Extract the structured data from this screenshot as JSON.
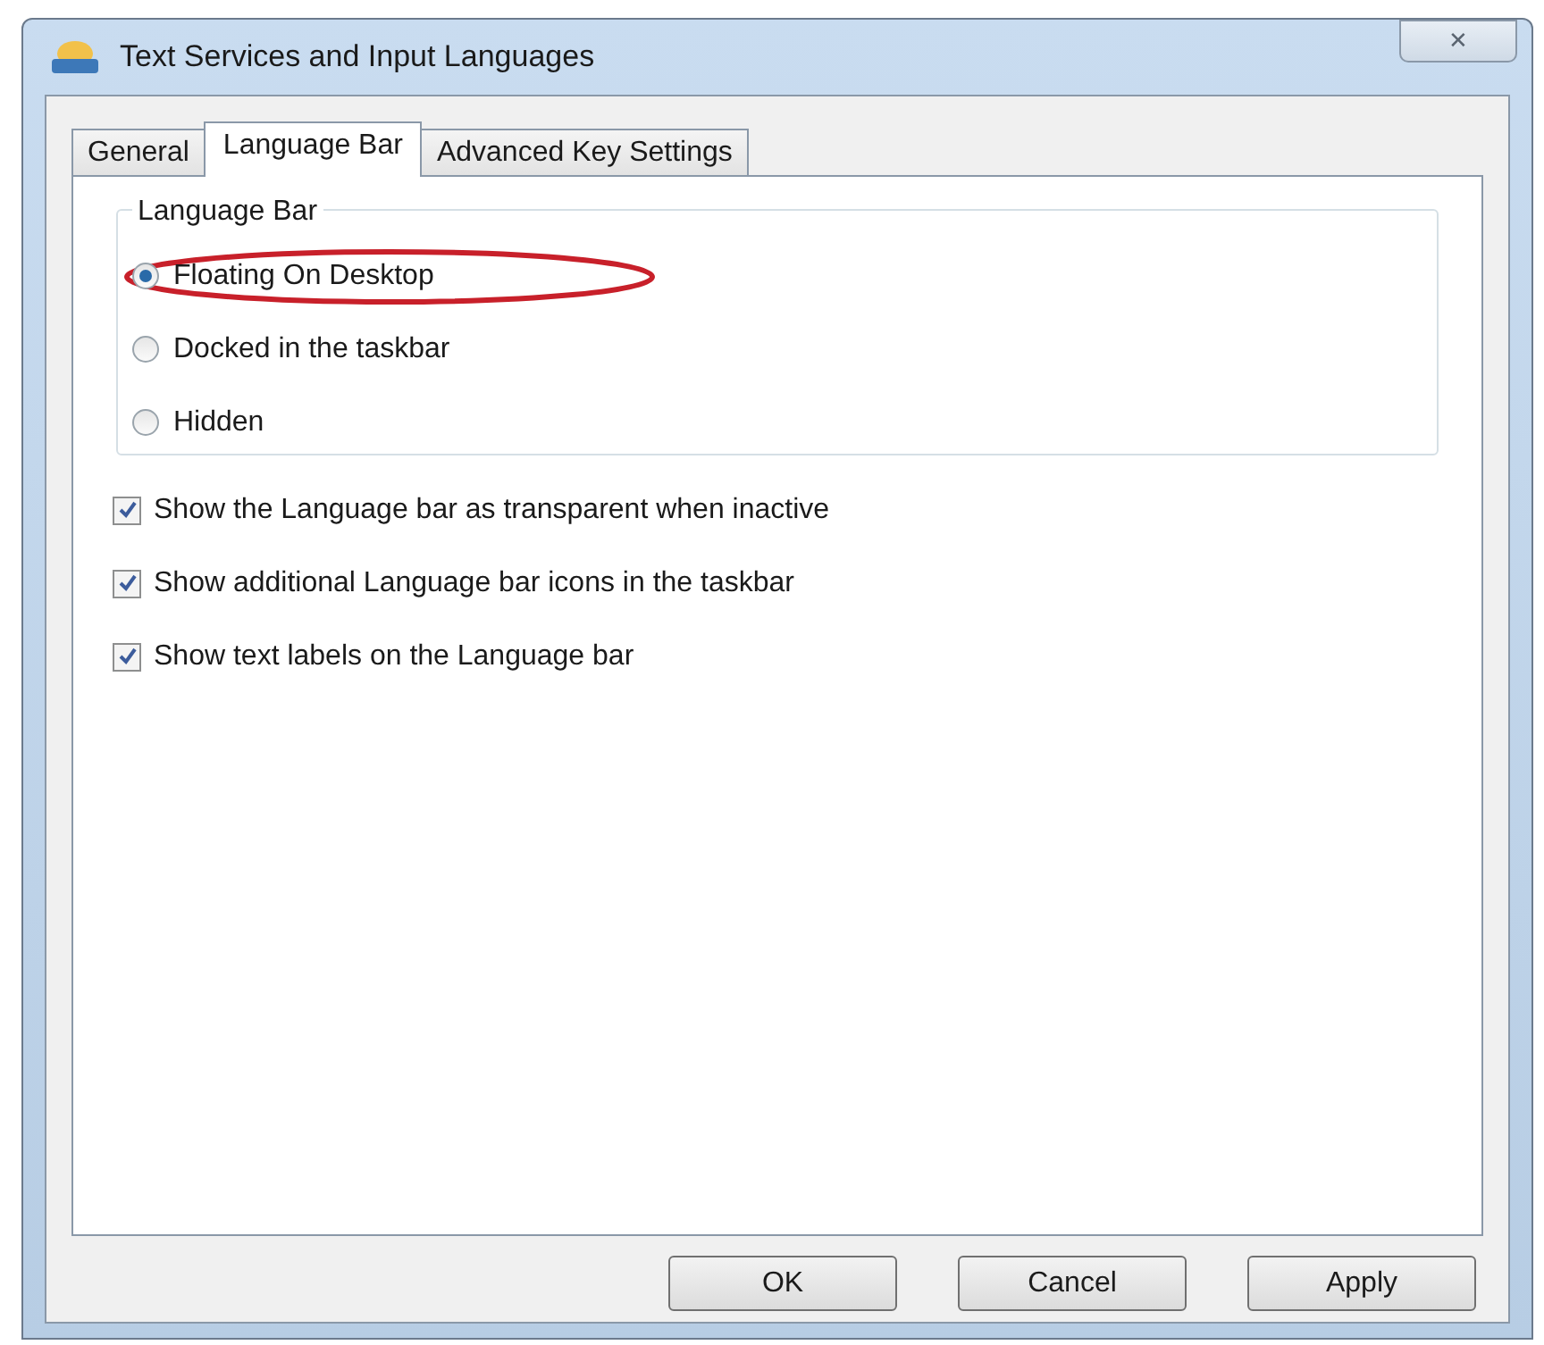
{
  "window": {
    "title": "Text Services and Input Languages",
    "close": "✕"
  },
  "tabs": [
    {
      "label": "General",
      "selected": false
    },
    {
      "label": "Language Bar",
      "selected": true
    },
    {
      "label": "Advanced Key Settings",
      "selected": false
    }
  ],
  "group": {
    "legend": "Language Bar",
    "options": [
      {
        "label": "Floating On Desktop",
        "selected": true,
        "highlighted": true
      },
      {
        "label": "Docked in the taskbar",
        "selected": false,
        "highlighted": false
      },
      {
        "label": "Hidden",
        "selected": false,
        "highlighted": false
      }
    ]
  },
  "checkboxes": [
    {
      "label": "Show the Language bar as transparent when inactive",
      "checked": true
    },
    {
      "label": "Show additional Language bar icons in the taskbar",
      "checked": true
    },
    {
      "label": "Show text labels on the Language bar",
      "checked": true
    }
  ],
  "buttons": [
    "OK",
    "Cancel",
    "Apply"
  ]
}
